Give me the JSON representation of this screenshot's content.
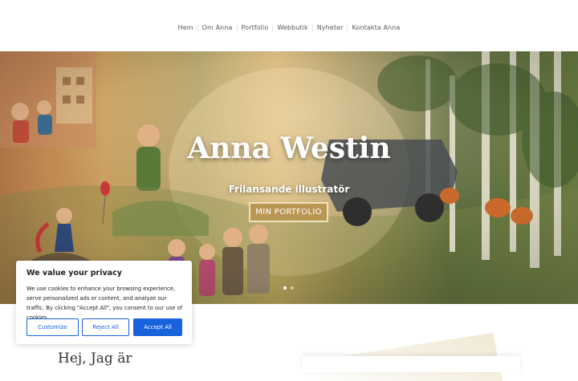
{
  "nav": {
    "items": [
      {
        "label": "Hem"
      },
      {
        "label": "Om Anna"
      },
      {
        "label": "Portfolio"
      },
      {
        "label": "Webbutik"
      },
      {
        "label": "Nyheter"
      },
      {
        "label": "Kontakta Anna"
      }
    ]
  },
  "hero": {
    "title": "Anna Westin",
    "subtitle": "Frilansande illustratör",
    "button_label": "MIN PORTFOLIO",
    "slides": {
      "count": 2,
      "active": 1
    }
  },
  "section": {
    "heading": "Hej, Jag är"
  },
  "cookie_banner": {
    "title": "We value your privacy",
    "text": "We use cookies to enhance your browsing experience, serve personalized ads or content, and analyze our traffic. By clicking \"Accept All\", you consent to our use of cookies.",
    "customize_label": "Customize",
    "reject_label": "Reject All",
    "accept_label": "Accept All"
  },
  "colors": {
    "accent_gold": "#b99752",
    "cookie_blue": "#1863dc"
  }
}
